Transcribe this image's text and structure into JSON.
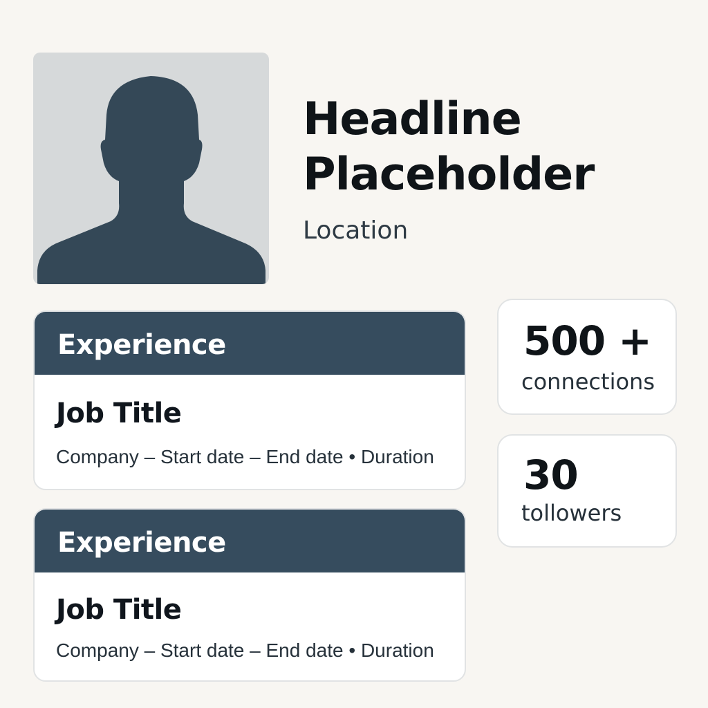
{
  "profile": {
    "avatar_icon": "person-silhouette-icon",
    "headline": "Headline Placeholder",
    "location": "Location"
  },
  "experience": [
    {
      "section_label": "Experience",
      "job_title": "Job Title",
      "meta": "Company – Start date – End date  •  Duration"
    },
    {
      "section_label": "Experience",
      "job_title": "Job Title",
      "meta": "Company – Start date – End date  •  Duration"
    }
  ],
  "stats": {
    "connections": {
      "value": "500 +",
      "label": "connections"
    },
    "followers": {
      "value": "30",
      "label": "tollowers"
    }
  },
  "colors": {
    "background": "#f8f6f2",
    "card_header": "#364c5e",
    "silhouette": "#344857",
    "avatar_background": "#d6d9da"
  }
}
